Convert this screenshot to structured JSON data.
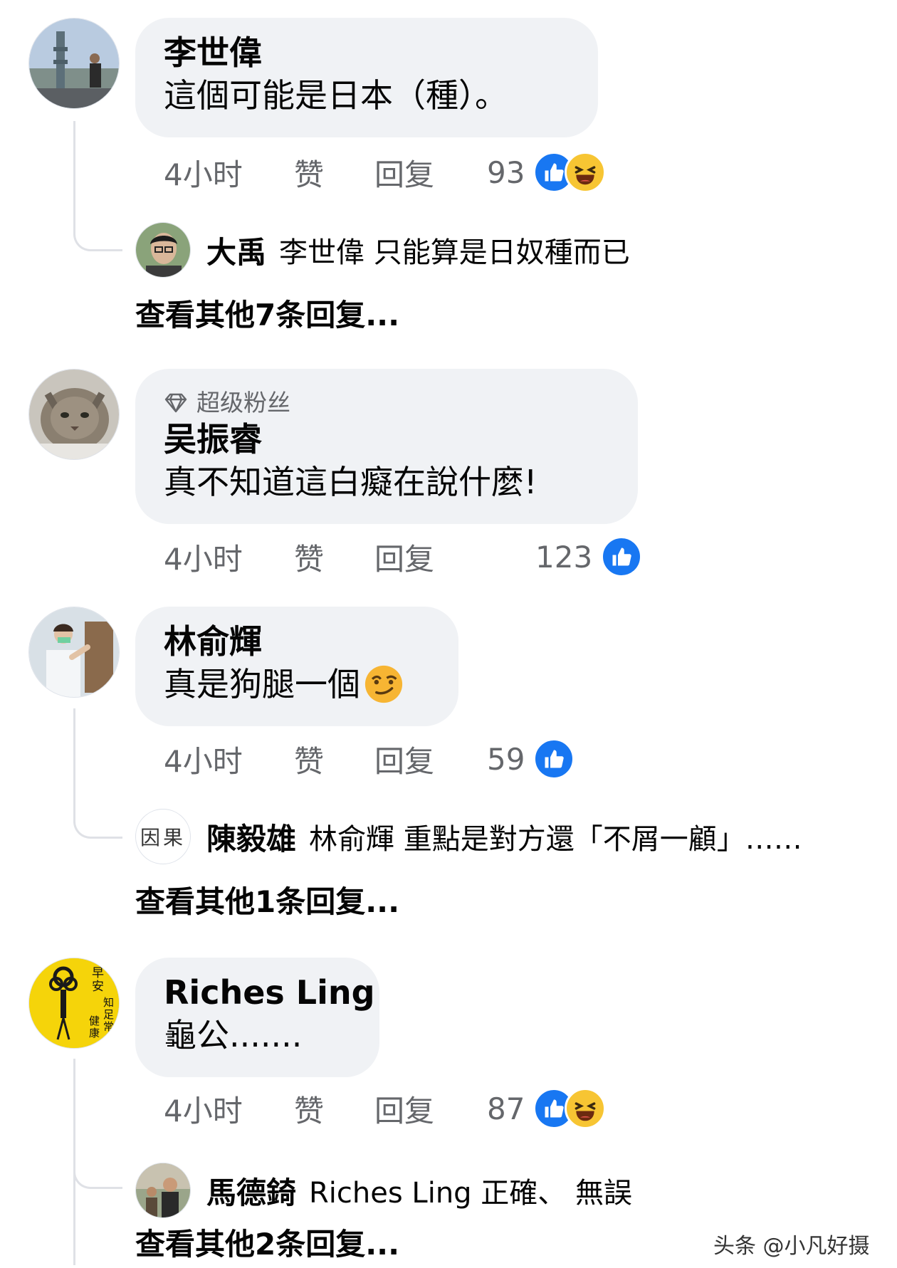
{
  "comments": [
    {
      "name": "李世偉",
      "text": "這個可能是日本（種）。",
      "time": "4小时",
      "like": "赞",
      "reply": "回复",
      "reaction_count": "93",
      "reply_preview": {
        "name": "大禹",
        "text": "李世偉 只能算是日奴種而已"
      },
      "more_replies": "查看其他7条回复..."
    },
    {
      "badge": "超级粉丝",
      "name": "吴振睿",
      "text": "真不知道這白癡在說什麼!",
      "time": "4小时",
      "like": "赞",
      "reply": "回复",
      "reaction_count": "123"
    },
    {
      "name": "林俞輝",
      "text": "真是狗腿一個",
      "time": "4小时",
      "like": "赞",
      "reply": "回复",
      "reaction_count": "59",
      "reply_preview": {
        "avatar_text": "因果",
        "name": "陳毅雄",
        "text": "林俞輝 重點是對方還「不屑一顧」……"
      },
      "more_replies": "查看其他1条回复..."
    },
    {
      "name": "Riches Ling",
      "text": "龜公.......",
      "time": "4小时",
      "like": "赞",
      "reply": "回复",
      "reaction_count": "87",
      "reply_preview": {
        "name": "馬德錡",
        "text": "Riches Ling 正確、 無誤"
      },
      "more_replies": "查看其他2条回复..."
    }
  ],
  "avatar4_text": {
    "a": "早安",
    "b": "知足常",
    "c": "健康"
  },
  "watermark": "头条 @小凡好摄",
  "colors": {
    "like_blue": "#1877f2",
    "haha_yellow": "#f7c533",
    "bubble_gray": "#f0f2f5",
    "meta_gray": "#65676b"
  }
}
